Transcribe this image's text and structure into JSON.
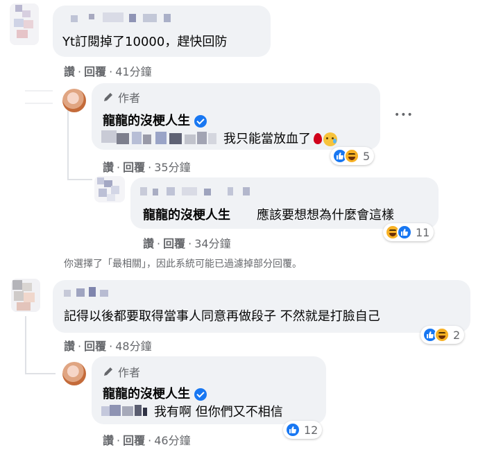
{
  "colors": {
    "bubble_bg": "#f0f2f5",
    "secondary_text": "#65676b",
    "like_blue": "#1877f2",
    "haha_yellow": "#f7b125"
  },
  "comments": [
    {
      "text": "Yt訂閱掉了10000，趕快回防",
      "actions": {
        "like": "讚",
        "reply": "回覆",
        "time": "41分鐘"
      },
      "replies": [
        {
          "author_badge": "作者",
          "author": "龍龍的沒梗人生",
          "text": "我只能當放血了",
          "actions": {
            "like": "讚",
            "reply": "回覆",
            "time": "35分鐘"
          },
          "reactions": {
            "icons": [
              "like-icon",
              "haha-icon"
            ],
            "count": "5"
          },
          "more_menu": "•••"
        },
        {
          "author": "龍龍的沒梗人生",
          "text": "應該要想想為什麼會這樣",
          "actions": {
            "like": "讚",
            "reply": "回覆",
            "time": "34分鐘"
          },
          "reactions": {
            "icons": [
              "haha-icon",
              "like-icon"
            ],
            "count": "11"
          }
        }
      ]
    },
    {
      "notice": "你選擇了「最相關」，因此系統可能已過濾掉部分回覆。"
    },
    {
      "text": "記得以後都要取得當事人同意再做段子 不然就是打臉自己",
      "actions": {
        "like": "讚",
        "reply": "回覆",
        "time": "48分鐘"
      },
      "reactions": {
        "icons": [
          "like-icon",
          "haha-icon"
        ],
        "count": "2"
      },
      "replies": [
        {
          "author_badge": "作者",
          "author": "龍龍的沒梗人生",
          "text": "我有啊 但你們又不相信",
          "actions": {
            "like": "讚",
            "reply": "回覆",
            "time": "46分鐘"
          },
          "reactions": {
            "icons": [
              "like-icon"
            ],
            "count": "12"
          }
        }
      ]
    }
  ]
}
